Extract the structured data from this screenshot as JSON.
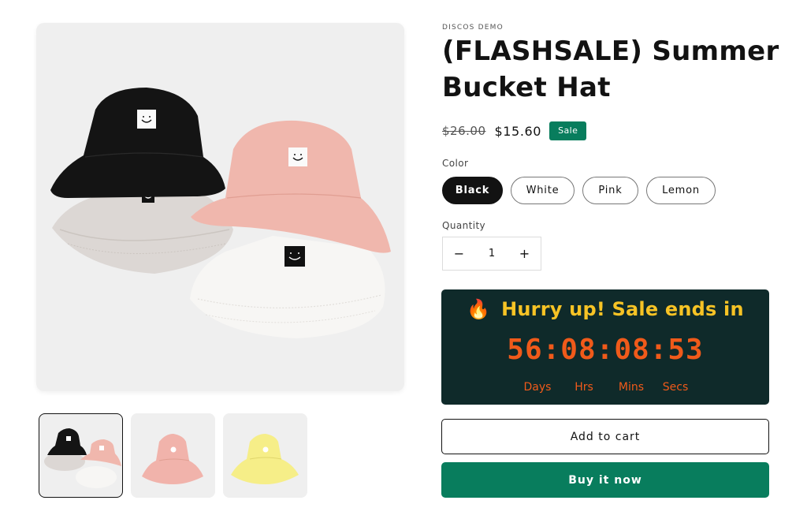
{
  "product": {
    "vendor": "DISCOS DEMO",
    "title": "(FLASHSALE) Summer Bucket Hat",
    "price_compare": "$26.00",
    "price_sale": "$15.60",
    "sale_badge": "Sale"
  },
  "color": {
    "label": "Color",
    "options": [
      "Black",
      "White",
      "Pink",
      "Lemon"
    ],
    "selected": "Black"
  },
  "quantity": {
    "label": "Quantity",
    "value": "1",
    "decrease_icon": "−",
    "increase_icon": "+"
  },
  "countdown": {
    "icon": "🔥",
    "heading": "Hurry up! Sale ends in",
    "time": "56:08:08:53",
    "units": [
      "Days",
      "Hrs",
      "Mins",
      "Secs"
    ]
  },
  "buttons": {
    "add_to_cart": "Add to cart",
    "buy_now": "Buy it now"
  },
  "media": {
    "thumbnails": [
      "black-white-pink-hats",
      "pink-hat",
      "lemon-hat"
    ],
    "active_thumbnail": 0
  },
  "colors": {
    "accent": "#087d5d",
    "timer_bg": "#0f2a2a",
    "timer_heading": "#f7c325",
    "timer_digits": "#f05a1a"
  }
}
